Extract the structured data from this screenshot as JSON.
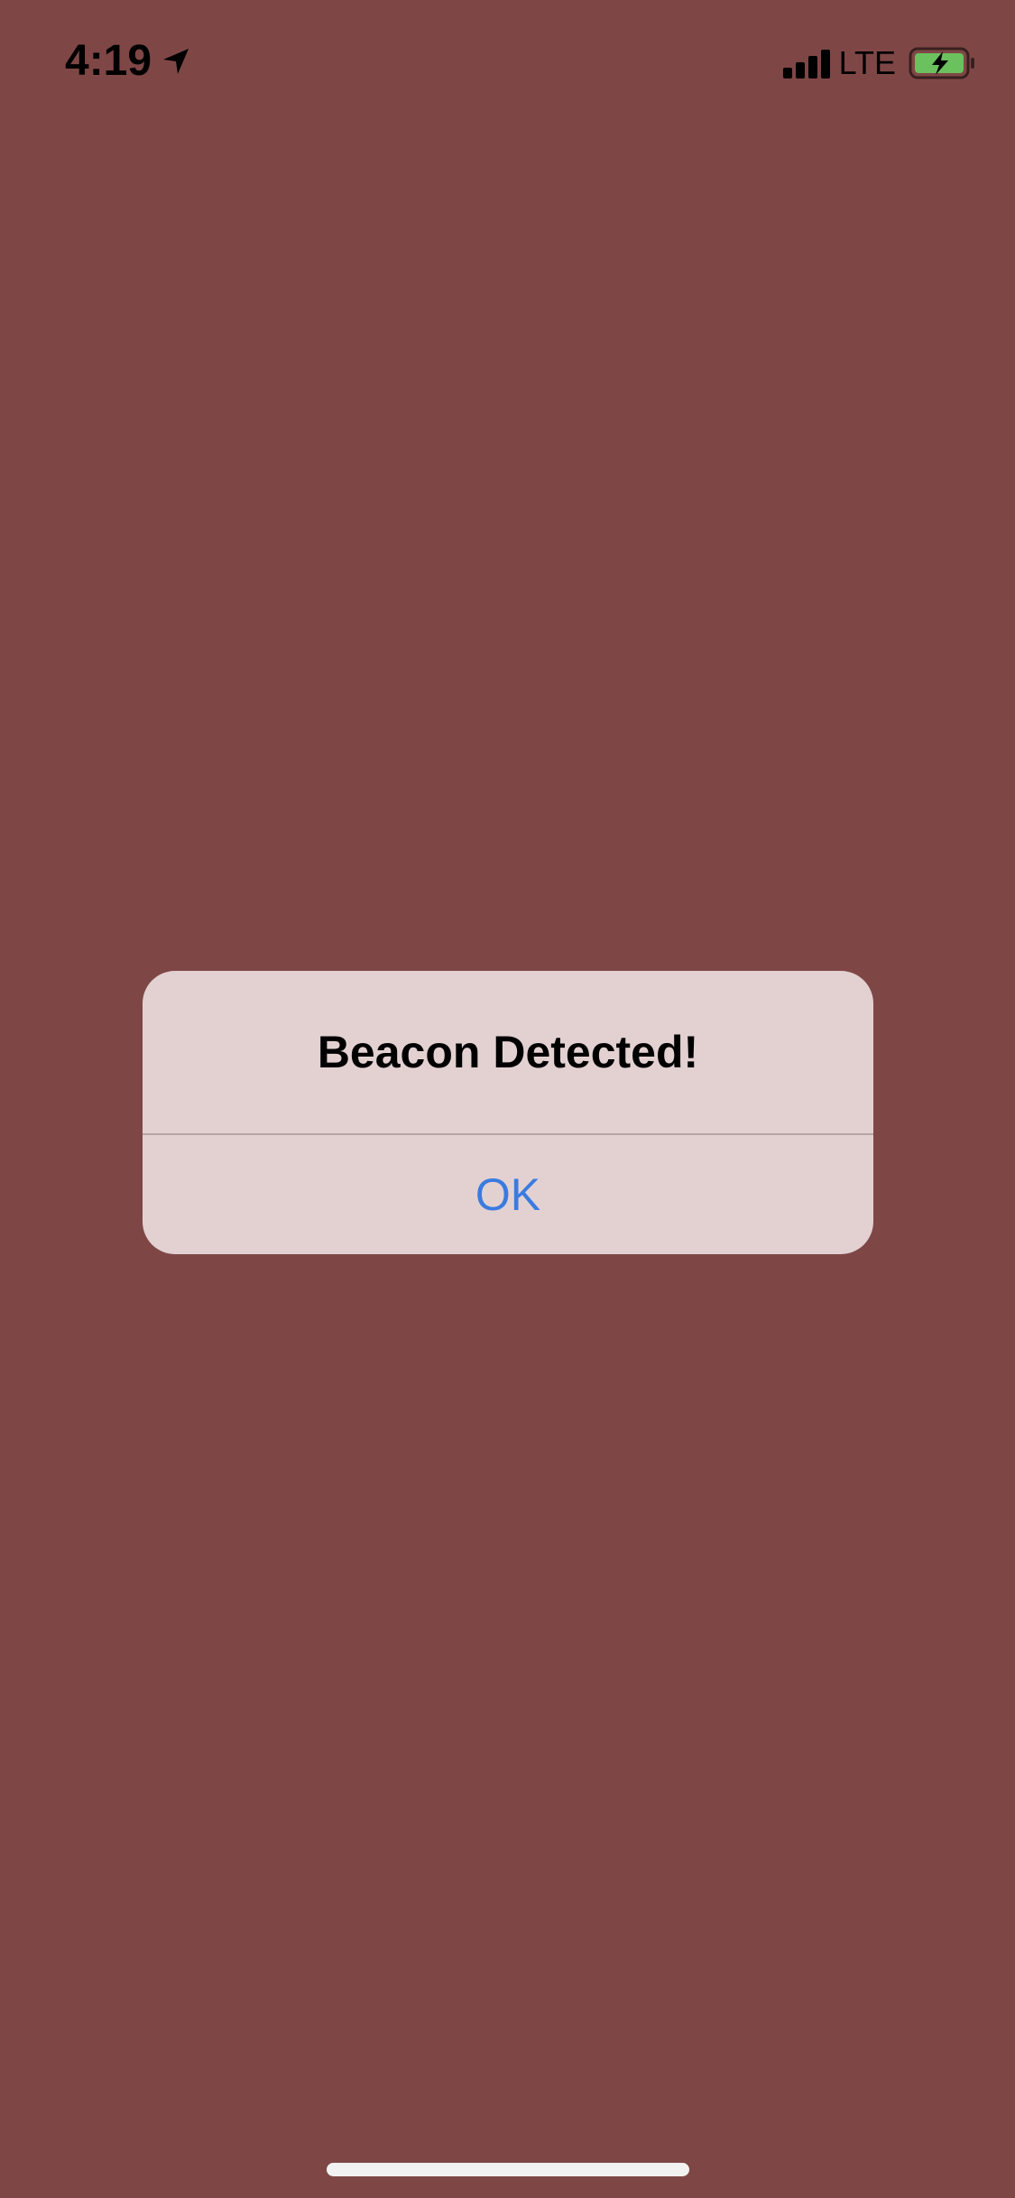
{
  "status_bar": {
    "time": "4:19",
    "network": "LTE",
    "location_icon": "location-arrow-icon",
    "signal_icon": "cellular-signal-icon",
    "battery_icon": "battery-charging-icon",
    "battery_fill_color": "#6BC15D"
  },
  "alert": {
    "title": "Beacon Detected!",
    "ok_label": "OK",
    "button_color": "#3A7BE0",
    "background_color": "#E3D1D2"
  },
  "app": {
    "background_color": "#7E4746"
  }
}
